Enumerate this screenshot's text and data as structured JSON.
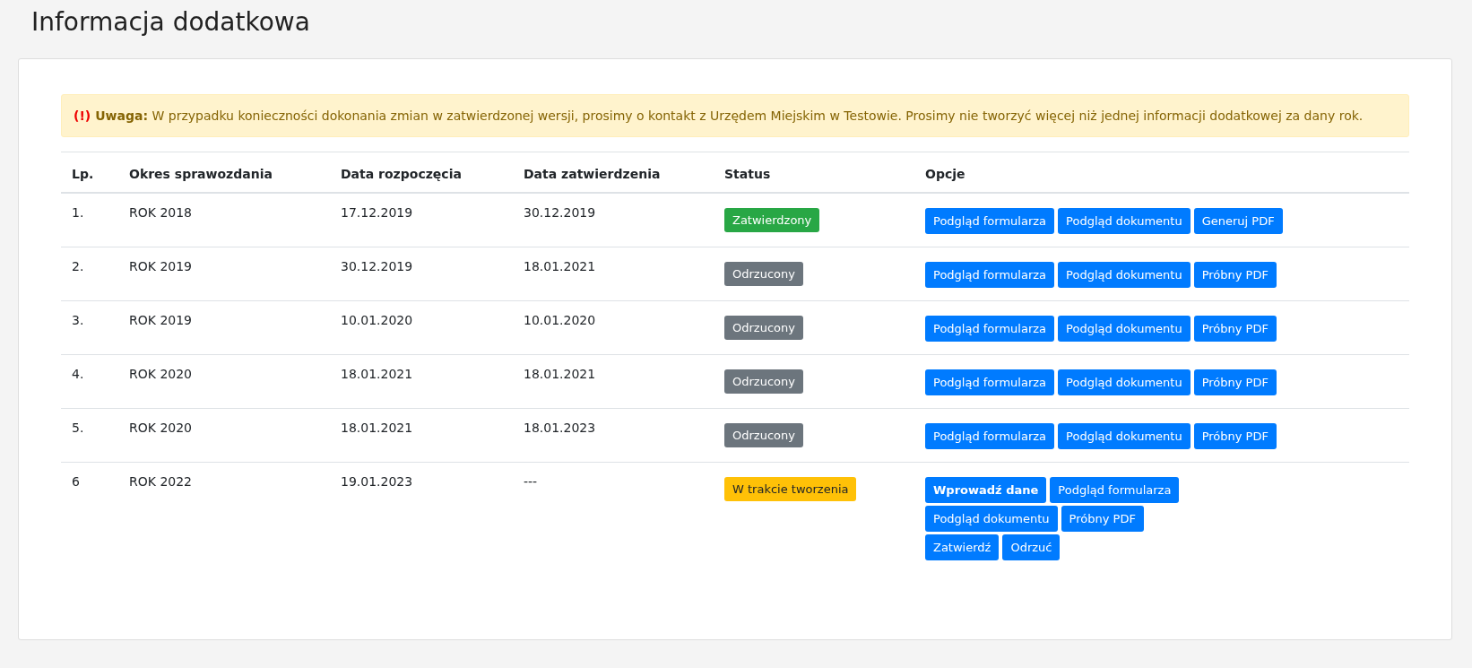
{
  "page_title": "Informacja dodatkowa",
  "alert": {
    "mark": "(!)",
    "text": "**Uwaga:** W przypadku konieczności dokonania zmian w zatwierdzonej wersji, prosimy o kontakt z Urzędem Miejskim w Testowie. Prosimy nie tworzyć więcej niż jednej informacji dodatkowej za dany rok."
  },
  "table": {
    "columns": [
      "Lp.",
      "Okres sprawozdania",
      "Data rozpoczęcia",
      "Data zatwierdzenia",
      "Status",
      "Opcje"
    ],
    "rows": [
      {
        "lp": "1.",
        "period": "ROK 2018",
        "start": "17.12.2019",
        "approved": "30.12.2019",
        "status": {
          "label": "Zatwierdzony",
          "kind": "approved"
        },
        "option_lines": [
          [
            {
              "label": "Podgląd formularza",
              "kind": "normal"
            },
            {
              "label": "Podgląd dokumentu",
              "kind": "normal"
            },
            {
              "label": "Generuj PDF",
              "kind": "normal"
            }
          ]
        ]
      },
      {
        "lp": "2.",
        "period": "ROK 2019",
        "start": "30.12.2019",
        "approved": "18.01.2021",
        "status": {
          "label": "Odrzucony",
          "kind": "rejected"
        },
        "option_lines": [
          [
            {
              "label": "Podgląd formularza",
              "kind": "normal"
            },
            {
              "label": "Podgląd dokumentu",
              "kind": "normal"
            },
            {
              "label": "Próbny PDF",
              "kind": "normal"
            }
          ]
        ]
      },
      {
        "lp": "3.",
        "period": "ROK 2019",
        "start": "10.01.2020",
        "approved": "10.01.2020",
        "status": {
          "label": "Odrzucony",
          "kind": "rejected"
        },
        "option_lines": [
          [
            {
              "label": "Podgląd formularza",
              "kind": "normal"
            },
            {
              "label": "Podgląd dokumentu",
              "kind": "normal"
            },
            {
              "label": "Próbny PDF",
              "kind": "normal"
            }
          ]
        ]
      },
      {
        "lp": "4.",
        "period": "ROK 2020",
        "start": "18.01.2021",
        "approved": "18.01.2021",
        "status": {
          "label": "Odrzucony",
          "kind": "rejected"
        },
        "option_lines": [
          [
            {
              "label": "Podgląd formularza",
              "kind": "normal"
            },
            {
              "label": "Podgląd dokumentu",
              "kind": "normal"
            },
            {
              "label": "Próbny PDF",
              "kind": "normal"
            }
          ]
        ]
      },
      {
        "lp": "5.",
        "period": "ROK 2020",
        "start": "18.01.2021",
        "approved": "18.01.2023",
        "status": {
          "label": "Odrzucony",
          "kind": "rejected"
        },
        "option_lines": [
          [
            {
              "label": "Podgląd formularza",
              "kind": "normal"
            },
            {
              "label": "Podgląd dokumentu",
              "kind": "normal"
            },
            {
              "label": "Próbny PDF",
              "kind": "normal"
            }
          ]
        ]
      },
      {
        "lp": "6",
        "period": "ROK 2022",
        "start": "19.01.2023",
        "approved": "---",
        "status": {
          "label": "W trakcie tworzenia",
          "kind": "draft"
        },
        "option_lines": [
          [
            {
              "label": "Wprowadź dane",
              "kind": "primary"
            },
            {
              "label": "Podgląd formularza",
              "kind": "normal"
            }
          ],
          [
            {
              "label": "Podgląd dokumentu",
              "kind": "normal"
            },
            {
              "label": "Próbny PDF",
              "kind": "normal"
            }
          ],
          [
            {
              "label": "Zatwierdź",
              "kind": "normal"
            },
            {
              "label": "Odrzuć",
              "kind": "normal"
            }
          ]
        ]
      }
    ]
  }
}
